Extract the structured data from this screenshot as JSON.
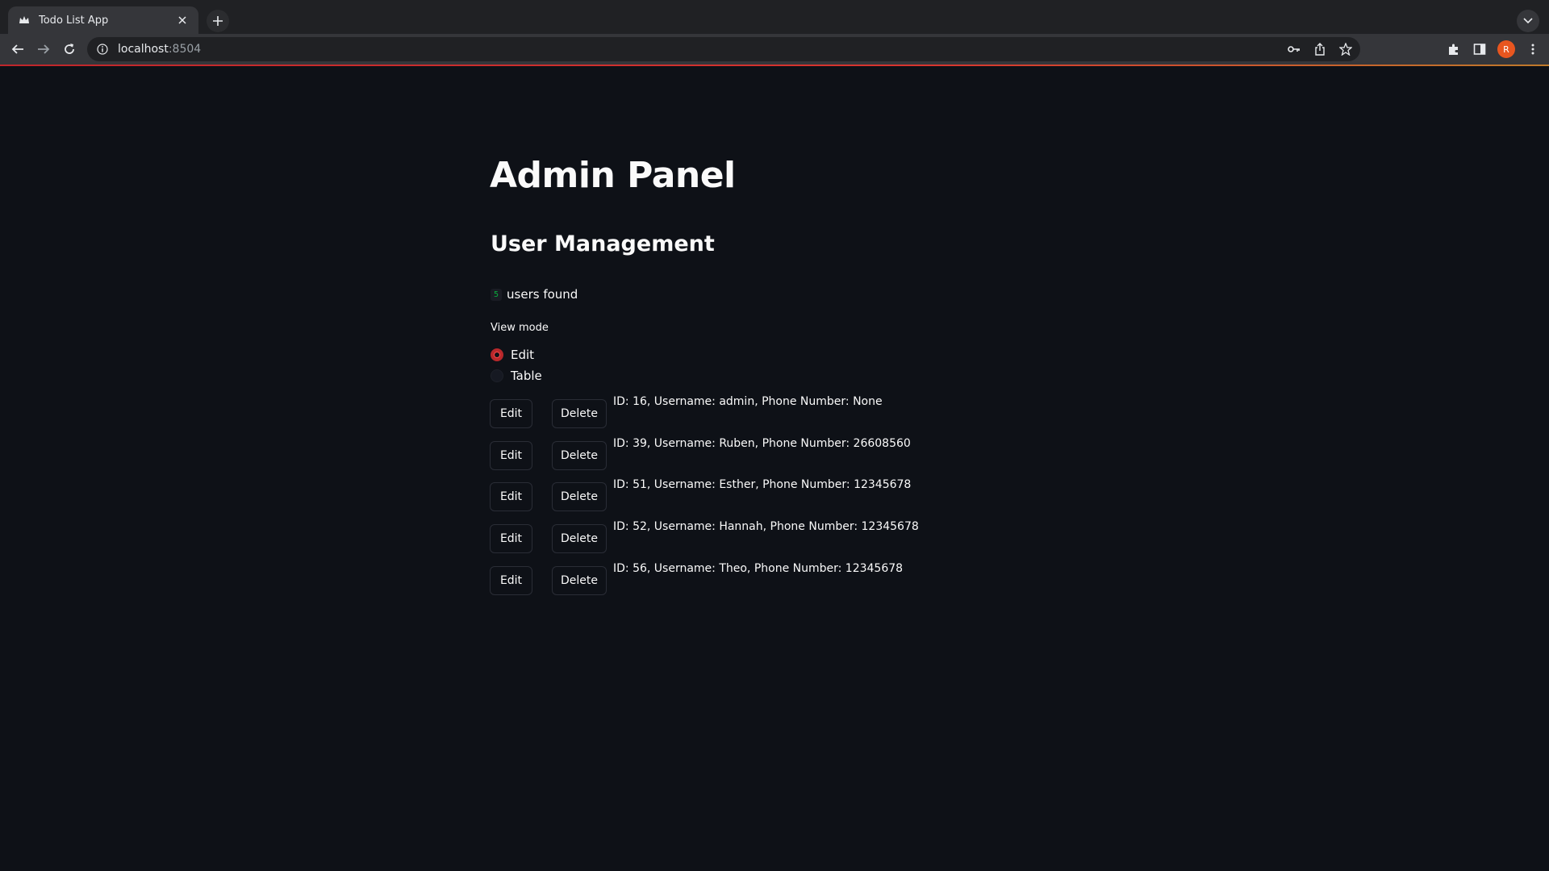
{
  "browser": {
    "tab_title": "Todo List App",
    "url_host": "localhost",
    "url_port": ":8504",
    "profile_initial": "R"
  },
  "icons": {
    "favicon": "streamlit-crown-icon",
    "tab_close": "close-icon",
    "new_tab": "plus-icon",
    "tab_search": "chevron-down-icon",
    "back": "arrow-left-icon",
    "forward": "arrow-right-icon",
    "reload": "reload-icon",
    "site_info": "info-icon",
    "password": "key-icon",
    "share": "share-icon",
    "bookmark": "star-icon",
    "extensions": "puzzle-icon",
    "side_panel": "side-panel-icon",
    "menu": "kebab-menu-icon"
  },
  "page": {
    "title": "Admin Panel",
    "section_title": "User Management",
    "user_count": "5",
    "user_count_suffix": "users found",
    "view_mode_label": "View mode",
    "view_mode_options": [
      "Edit",
      "Table"
    ],
    "view_mode_selected": "Edit",
    "edit_label": "Edit",
    "delete_label": "Delete",
    "users": [
      {
        "text": "ID: 16, Username: admin, Phone Number: None"
      },
      {
        "text": "ID: 39, Username: Ruben, Phone Number: 26608560"
      },
      {
        "text": "ID: 51, Username: Esther, Phone Number: 12345678"
      },
      {
        "text": "ID: 52, Username: Hannah, Phone Number: 12345678"
      },
      {
        "text": "ID: 56, Username: Theo, Phone Number: 12345678"
      }
    ]
  },
  "colors": {
    "app_background": "#0e1117",
    "primary": "#ff4b4b",
    "badge_green": "#09ab3b",
    "chrome_tabbar": "#202124",
    "chrome_toolbar": "#35363a"
  }
}
